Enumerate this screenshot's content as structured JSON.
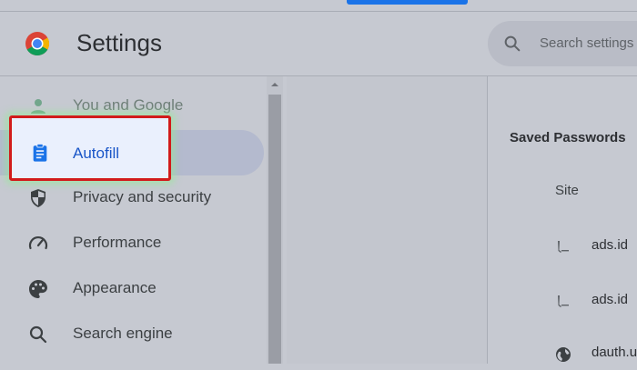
{
  "app": {
    "title": "Settings"
  },
  "search": {
    "placeholder": "Search settings"
  },
  "sidebar": {
    "items": [
      {
        "label": "You and Google",
        "icon": "person-icon"
      },
      {
        "label": "Autofill",
        "icon": "clipboard-icon"
      },
      {
        "label": "Privacy and security",
        "icon": "shield-icon"
      },
      {
        "label": "Performance",
        "icon": "speedometer-icon"
      },
      {
        "label": "Appearance",
        "icon": "palette-icon"
      },
      {
        "label": "Search engine",
        "icon": "search-icon"
      }
    ]
  },
  "passwords": {
    "title": "Saved Passwords",
    "column_site": "Site",
    "rows": [
      {
        "site": "ads.id",
        "icon": "site-favicon"
      },
      {
        "site": "ads.id",
        "icon": "site-favicon"
      },
      {
        "site": "dauth.u",
        "icon": "globe-icon"
      }
    ]
  },
  "colors": {
    "accent": "#1a73e8",
    "highlight_border": "#d21b1b"
  }
}
